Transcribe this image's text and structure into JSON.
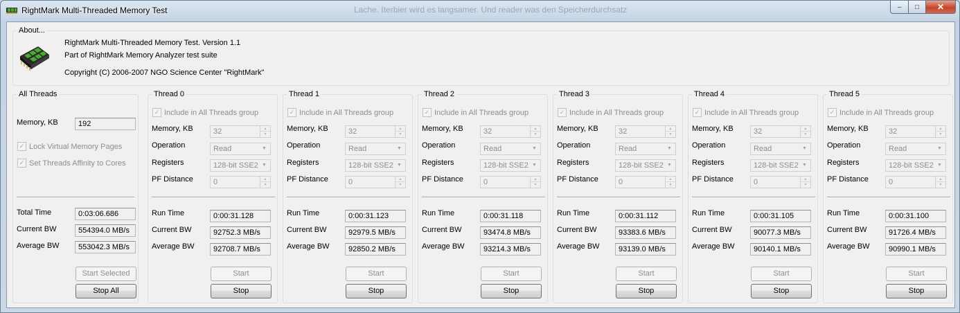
{
  "window": {
    "title": "RightMark Multi-Threaded Memory Test",
    "background_text": "Lache. Iterbier wird es langsamer. Und reader was den Speicherdurchsatz"
  },
  "about": {
    "label": "About...",
    "line1": "RightMark Multi-Threaded Memory Test. Version 1.1",
    "line2": "Part of RightMark Memory Analyzer test suite",
    "line3": "Copyright (C) 2006-2007 NGO Science Center \"RightMark\""
  },
  "all_threads": {
    "label": "All Threads",
    "memory_label": "Memory, KB",
    "memory_value": "192",
    "lock_pages_label": "Lock Virtual Memory Pages",
    "affinity_label": "Set Threads Affinity to Cores",
    "total_time_label": "Total Time",
    "total_time_value": "0:03:06.686",
    "current_bw_label": "Current BW",
    "current_bw_value": "554394.0 MB/s",
    "average_bw_label": "Average BW",
    "average_bw_value": "553042.3 MB/s",
    "start_selected_label": "Start Selected",
    "stop_all_label": "Stop All"
  },
  "thread_labels": {
    "include": "Include in All Threads group",
    "memory": "Memory, KB",
    "operation": "Operation",
    "registers": "Registers",
    "pf_distance": "PF Distance",
    "run_time": "Run Time",
    "current_bw": "Current BW",
    "average_bw": "Average BW",
    "start": "Start",
    "stop": "Stop"
  },
  "threads": [
    {
      "name": "Thread 0",
      "memory": "32",
      "operation": "Read",
      "registers": "128-bit SSE2",
      "pf_distance": "0",
      "run_time": "0:00:31.128",
      "current_bw": "92752.3 MB/s",
      "average_bw": "92708.7 MB/s"
    },
    {
      "name": "Thread 1",
      "memory": "32",
      "operation": "Read",
      "registers": "128-bit SSE2",
      "pf_distance": "0",
      "run_time": "0:00:31.123",
      "current_bw": "92979.5 MB/s",
      "average_bw": "92850.2 MB/s"
    },
    {
      "name": "Thread 2",
      "memory": "32",
      "operation": "Read",
      "registers": "128-bit SSE2",
      "pf_distance": "0",
      "run_time": "0:00:31.118",
      "current_bw": "93474.8 MB/s",
      "average_bw": "93214.3 MB/s"
    },
    {
      "name": "Thread 3",
      "memory": "32",
      "operation": "Read",
      "registers": "128-bit SSE2",
      "pf_distance": "0",
      "run_time": "0:00:31.112",
      "current_bw": "93383.6 MB/s",
      "average_bw": "93139.0 MB/s"
    },
    {
      "name": "Thread 4",
      "memory": "32",
      "operation": "Read",
      "registers": "128-bit SSE2",
      "pf_distance": "0",
      "run_time": "0:00:31.105",
      "current_bw": "90077.3 MB/s",
      "average_bw": "90140.1 MB/s"
    },
    {
      "name": "Thread 5",
      "memory": "32",
      "operation": "Read",
      "registers": "128-bit SSE2",
      "pf_distance": "0",
      "run_time": "0:00:31.100",
      "current_bw": "91726.4 MB/s",
      "average_bw": "90990.1 MB/s"
    }
  ],
  "icons": {
    "app": "memory-chip-icon",
    "minimize": "minimize-icon",
    "maximize": "maximize-icon",
    "close": "close-icon"
  },
  "colors": {
    "chip_green": "#3a9a2a",
    "close_red": "#c7452b",
    "disabled_text": "#8d8d8d"
  }
}
